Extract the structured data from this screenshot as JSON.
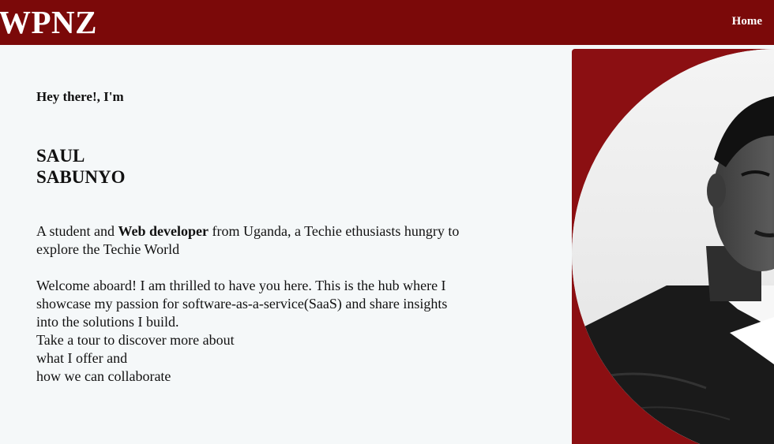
{
  "header": {
    "brand": "WPNZ",
    "nav": [
      {
        "label": "Home"
      }
    ]
  },
  "hero": {
    "greeting": "Hey there!, I'm",
    "name_first": "SAUL",
    "name_last": "SABUNYO",
    "intro_before": "A student and ",
    "intro_bold": "Web developer",
    "intro_after": " from Uganda, a Techie ethusiasts hungry to explore the Techie World",
    "welcome_lines": [
      "Welcome aboard! I am thrilled to have you here. This is the hub where I showcase my passion for software-as-a-service(SaaS) and share insights into the solutions I build.",
      "Take a tour to discover more about",
      "what I offer and",
      "how we can collaborate"
    ]
  },
  "colors": {
    "navbar": "#7b0909",
    "photo_card": "#8b0f12",
    "page_background": "#f5f8f9"
  }
}
